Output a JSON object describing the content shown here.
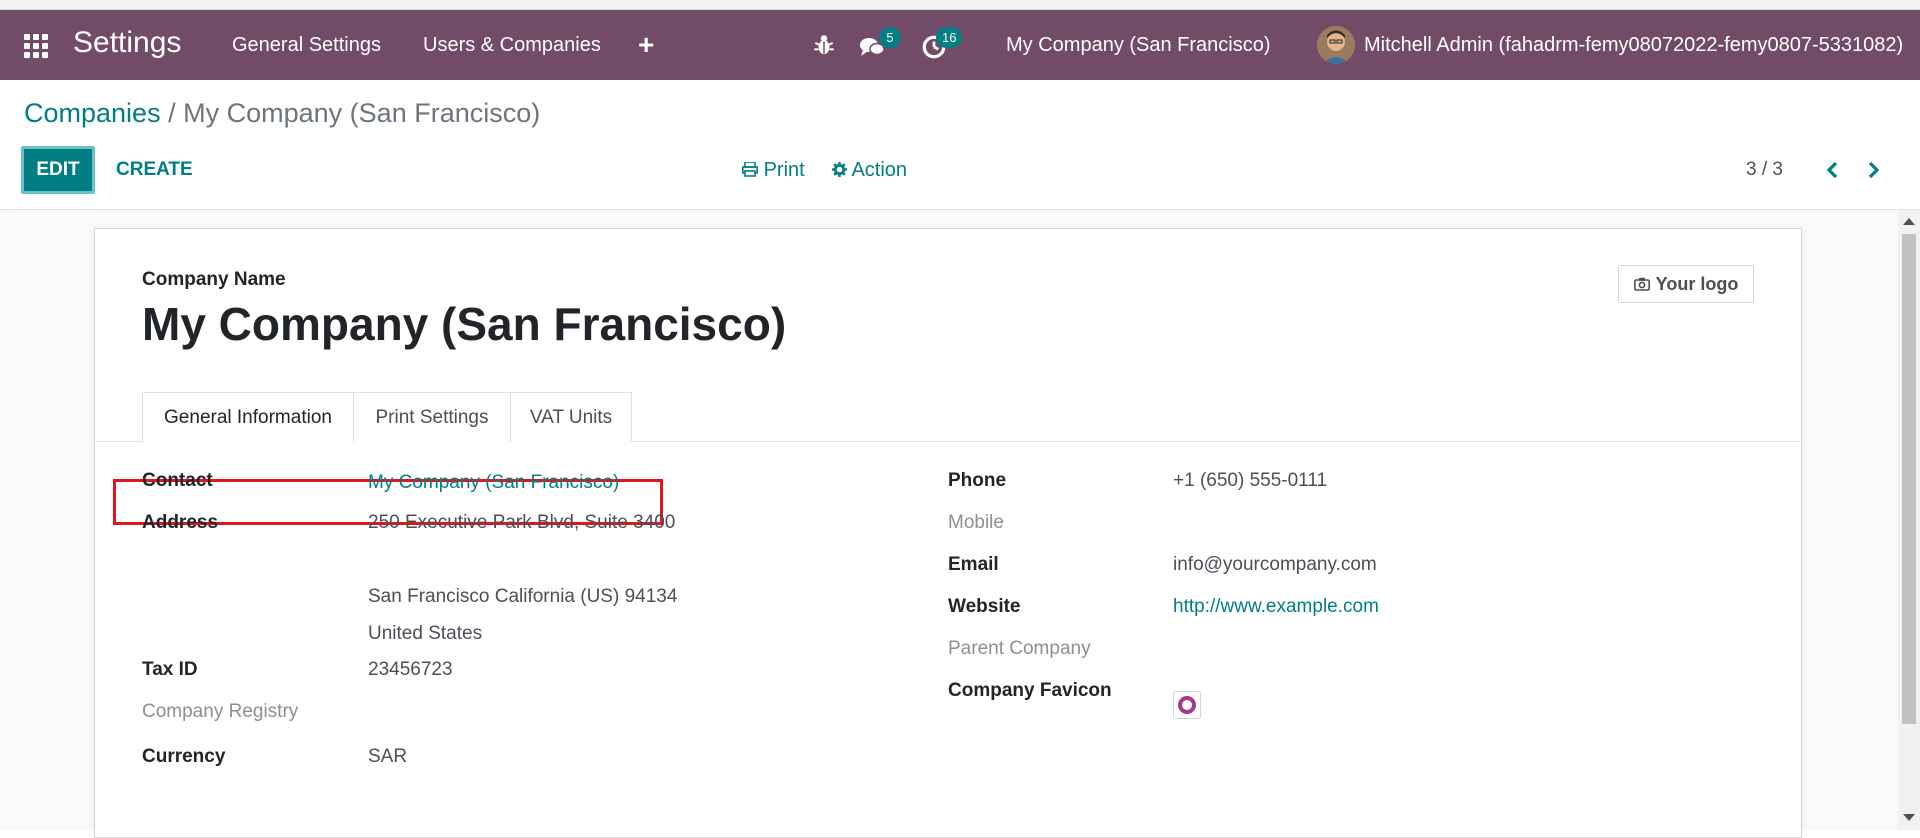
{
  "navbar": {
    "brand": "Settings",
    "menu": [
      "General Settings",
      "Users & Companies"
    ],
    "messages_count": "5",
    "activities_count": "16",
    "company": "My Company (San Francisco)",
    "user": "Mitchell Admin (fahadrm-femy08072022-femy0807-5331082)",
    "icons": {
      "apps": "apps-grid-icon",
      "plus": "plus-icon",
      "debug": "bug-icon",
      "messages": "chat-bubbles-icon",
      "activities": "clock-icon"
    },
    "colors": {
      "bar": "#714b67",
      "badge": "#017e84"
    }
  },
  "control_panel": {
    "breadcrumb_parent": "Companies",
    "breadcrumb_sep": "/",
    "breadcrumb_current": "My Company (San Francisco)",
    "edit_label": "EDIT",
    "create_label": "CREATE",
    "print_label": "Print",
    "action_label": "Action",
    "pager": "3 / 3"
  },
  "form": {
    "name_label": "Company Name",
    "name": "My Company (San Francisco)",
    "logo_label": "Your logo",
    "tabs": [
      "General Information",
      "Print Settings",
      "VAT Units"
    ],
    "left": {
      "contact_label": "Contact",
      "contact_value": "My Company (San Francisco)",
      "address_label": "Address",
      "address_line1": "250 Executive Park Blvd, Suite 3400",
      "address_city_line": "San Francisco  California (US)  94134",
      "address_country": "United States",
      "tax_label": "Tax ID",
      "tax_value": "23456723",
      "registry_label": "Company Registry",
      "currency_label": "Currency",
      "currency_value": "SAR"
    },
    "right": {
      "phone_label": "Phone",
      "phone_value": "+1 (650) 555-0111",
      "mobile_label": "Mobile",
      "email_label": "Email",
      "email_value": "info@yourcompany.com",
      "website_label": "Website",
      "website_value": "http://www.example.com",
      "parent_label": "Parent Company",
      "favicon_label": "Company Favicon"
    },
    "accent_color": "#017e84",
    "highlight_color": "#e2141c"
  }
}
